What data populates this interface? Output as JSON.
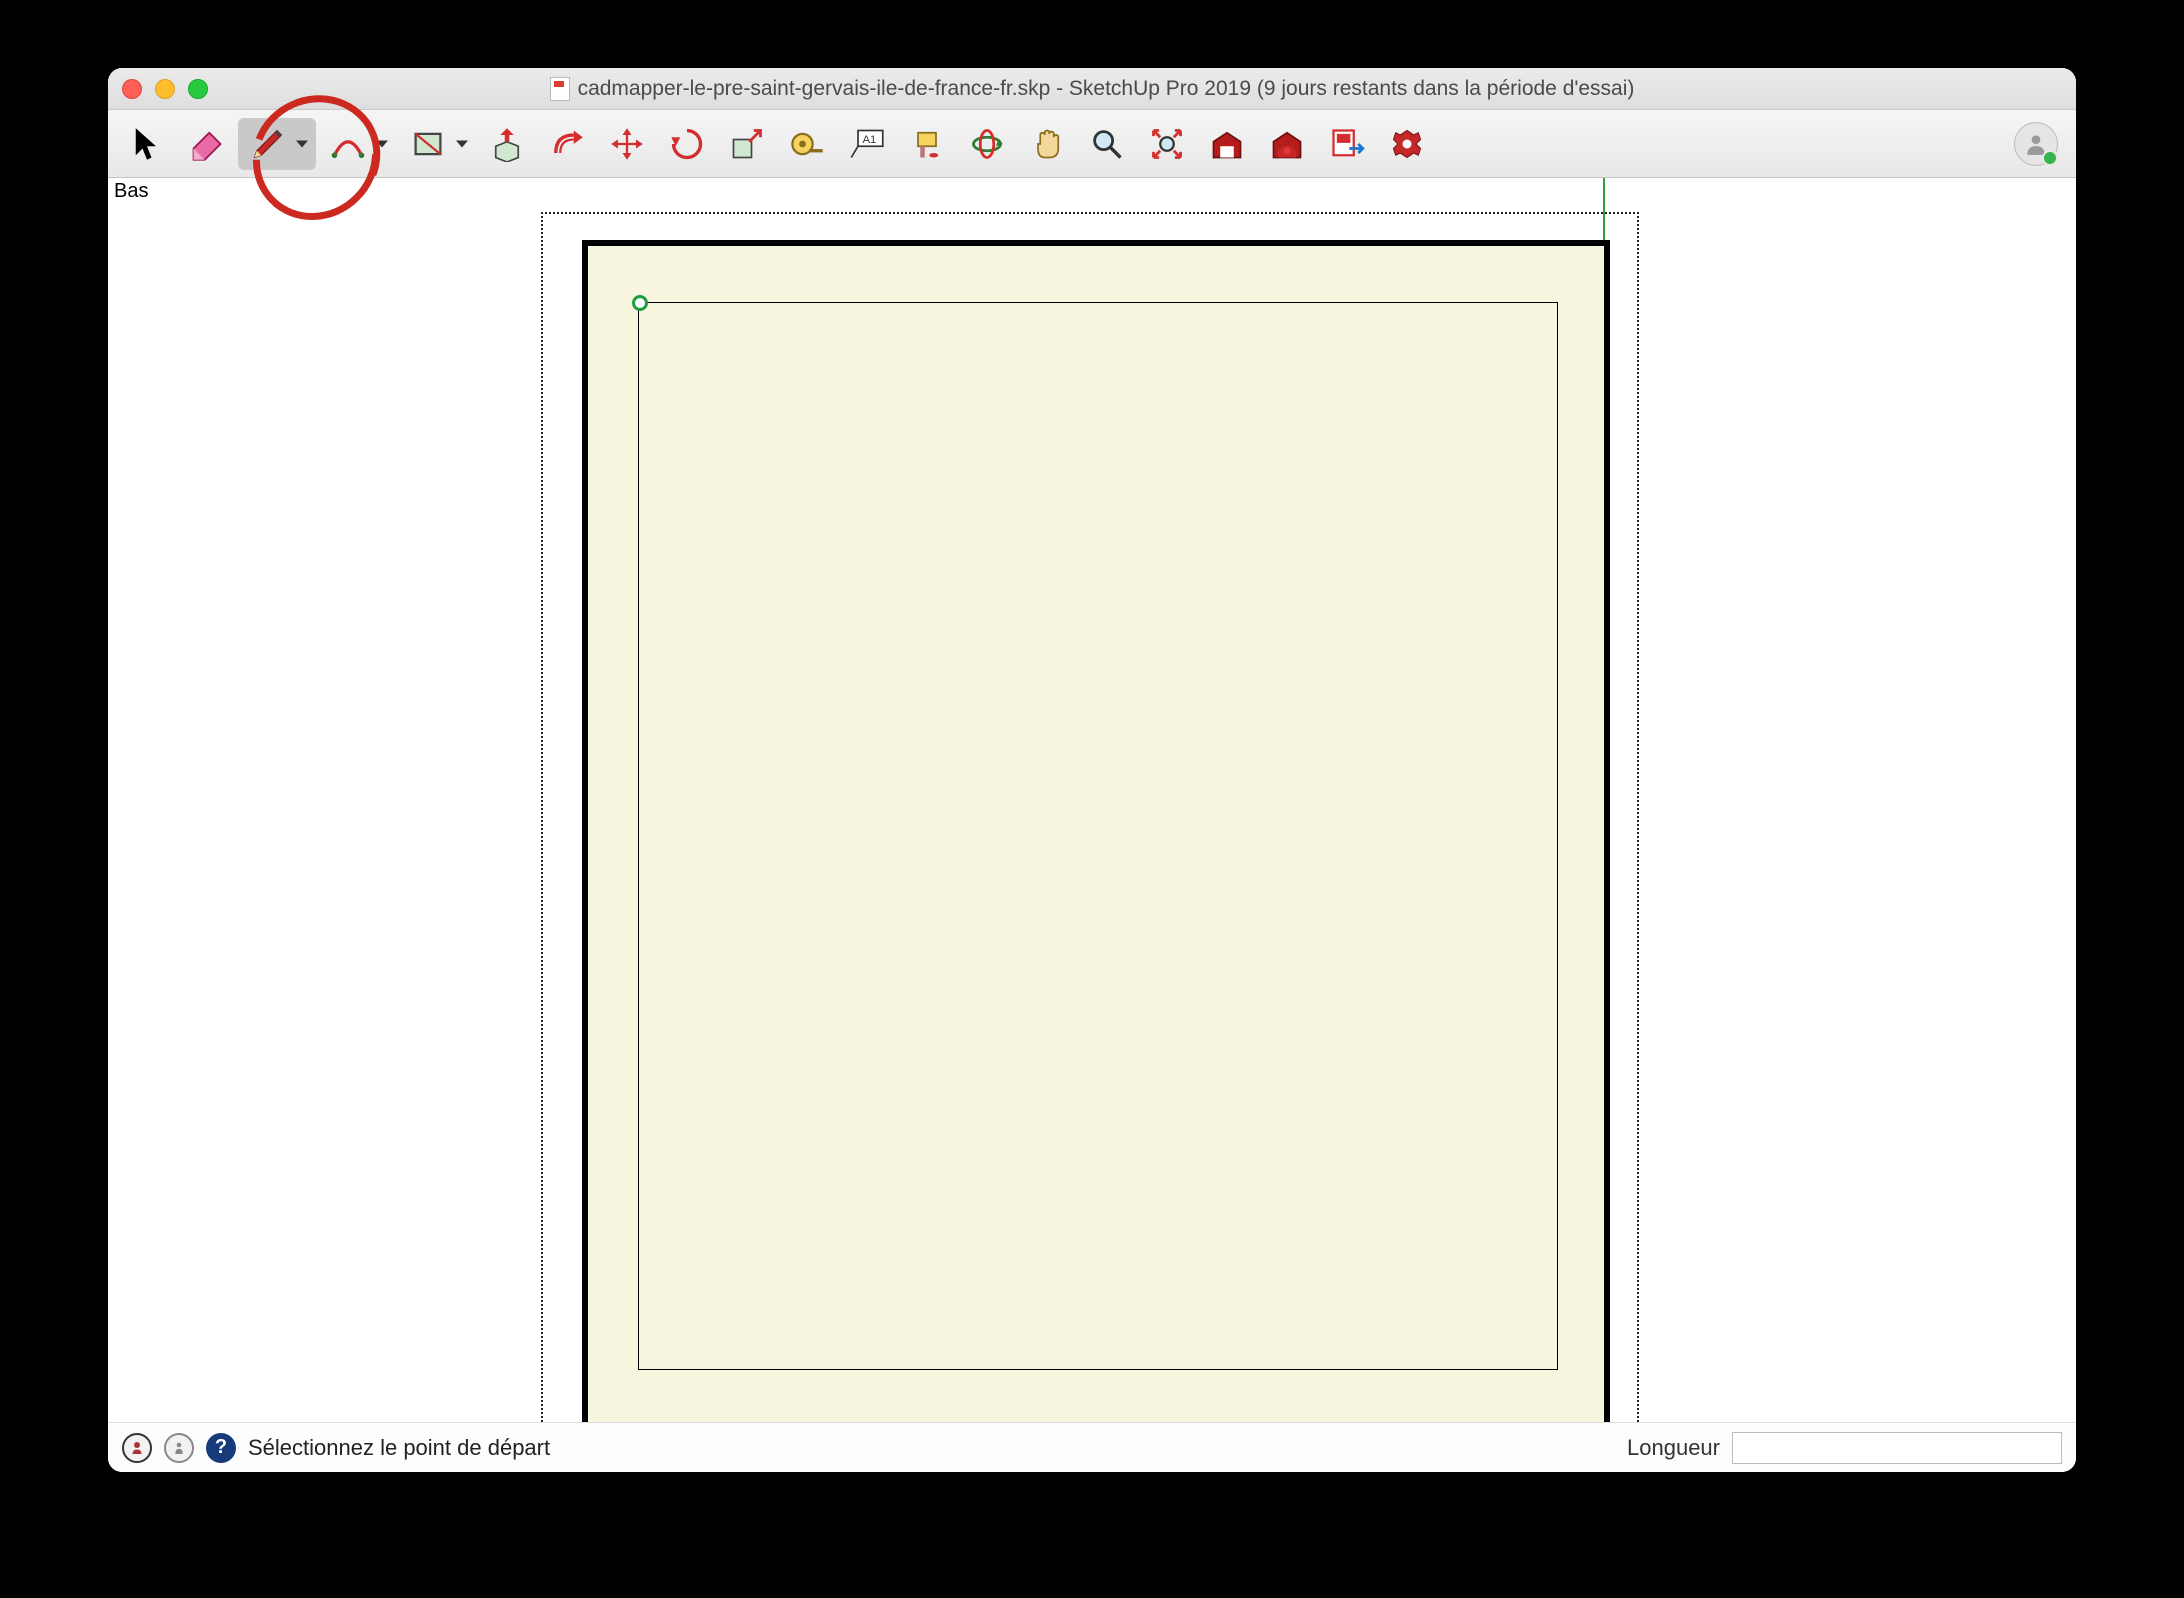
{
  "window": {
    "title": "cadmapper-le-pre-saint-gervais-ile-de-france-fr.skp - SketchUp Pro 2019 (9 jours restants dans la période d'essai)"
  },
  "toolbar": {
    "tools": [
      {
        "name": "select",
        "icon": "cursor",
        "dropdown": false
      },
      {
        "name": "eraser",
        "icon": "eraser",
        "dropdown": false
      },
      {
        "name": "line",
        "icon": "pencil",
        "dropdown": true,
        "selected": true
      },
      {
        "name": "arc",
        "icon": "arc",
        "dropdown": true
      },
      {
        "name": "shape",
        "icon": "rectangle",
        "dropdown": true
      },
      {
        "name": "pushpull",
        "icon": "pushpull",
        "dropdown": false
      },
      {
        "name": "offset",
        "icon": "offset",
        "dropdown": false
      },
      {
        "name": "move",
        "icon": "move",
        "dropdown": false
      },
      {
        "name": "rotate",
        "icon": "rotate",
        "dropdown": false
      },
      {
        "name": "scale",
        "icon": "scale",
        "dropdown": false
      },
      {
        "name": "tape",
        "icon": "tape",
        "dropdown": false
      },
      {
        "name": "text",
        "icon": "text",
        "dropdown": false
      },
      {
        "name": "paint",
        "icon": "paint",
        "dropdown": false
      },
      {
        "name": "orbit",
        "icon": "orbit",
        "dropdown": false
      },
      {
        "name": "pan",
        "icon": "pan",
        "dropdown": false
      },
      {
        "name": "zoom",
        "icon": "zoom",
        "dropdown": false
      },
      {
        "name": "zoom-extents",
        "icon": "zoom-extents",
        "dropdown": false
      },
      {
        "name": "warehouse",
        "icon": "warehouse",
        "dropdown": false
      },
      {
        "name": "extension-wh",
        "icon": "extension-wh",
        "dropdown": false
      },
      {
        "name": "layout",
        "icon": "layout",
        "dropdown": false
      },
      {
        "name": "extension-mgr",
        "icon": "extension-mgr",
        "dropdown": false
      }
    ]
  },
  "viewport": {
    "view_label": "Bas"
  },
  "statusbar": {
    "hint": "Sélectionnez le point de départ",
    "measure_label": "Longueur",
    "measure_value": ""
  },
  "annotation": {
    "circled_tool": "line"
  }
}
